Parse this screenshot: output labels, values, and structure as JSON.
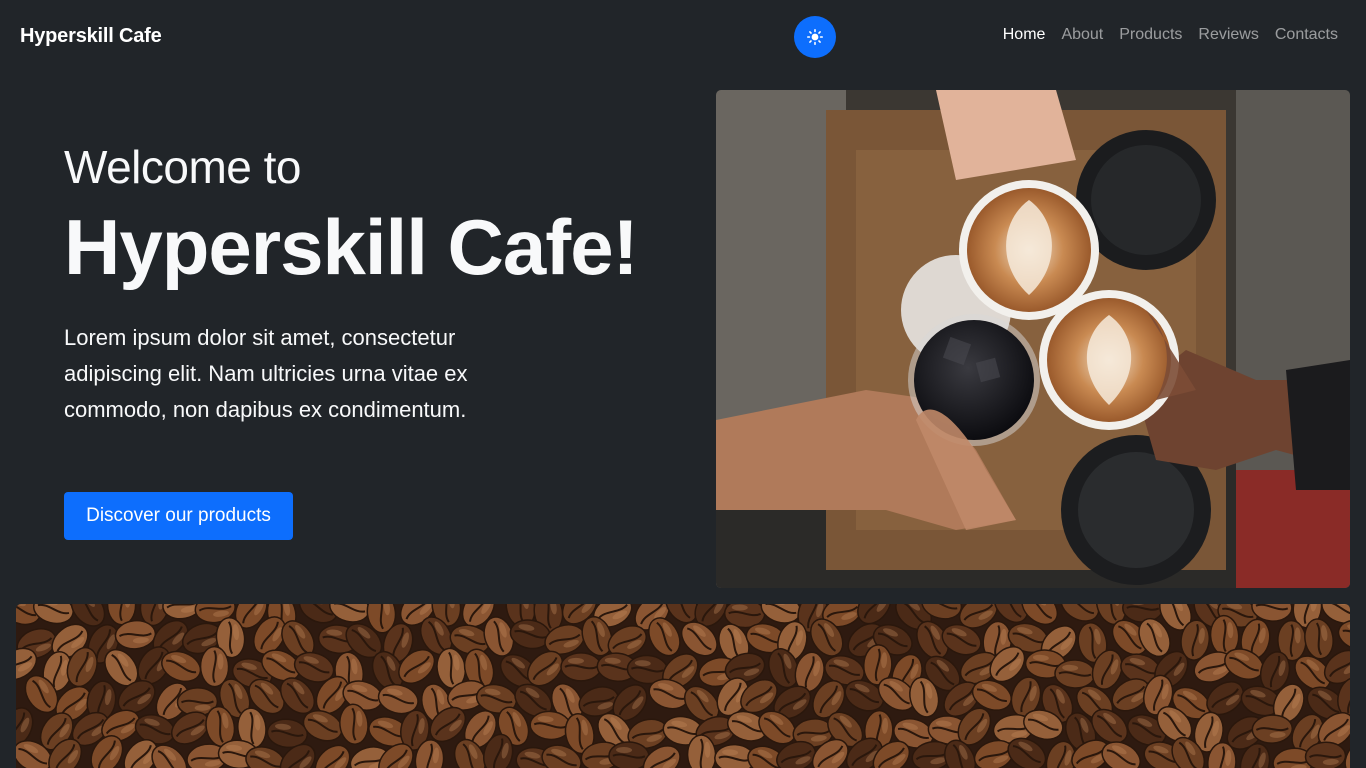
{
  "navbar": {
    "brand": "Hyperskill Cafe",
    "theme_toggle_icon": "sun-icon",
    "links": [
      "Home",
      "About",
      "Products",
      "Reviews",
      "Contacts"
    ],
    "active": "Home"
  },
  "hero": {
    "welcome": "Welcome to",
    "title": "Hyperskill Cafe!",
    "lead": "Lorem ipsum dolor sit amet, consectetur adipiscing elit. Nam ultricies urna vitae ex commodo, non dapibus ex condimentum.",
    "cta_label": "Discover our products",
    "image": "coffee-cups-toast-photo"
  },
  "banner": {
    "image": "coffee-beans-photo"
  },
  "colors": {
    "background": "#212529",
    "accent": "#0d6efd",
    "text": "#f8f9fa"
  }
}
